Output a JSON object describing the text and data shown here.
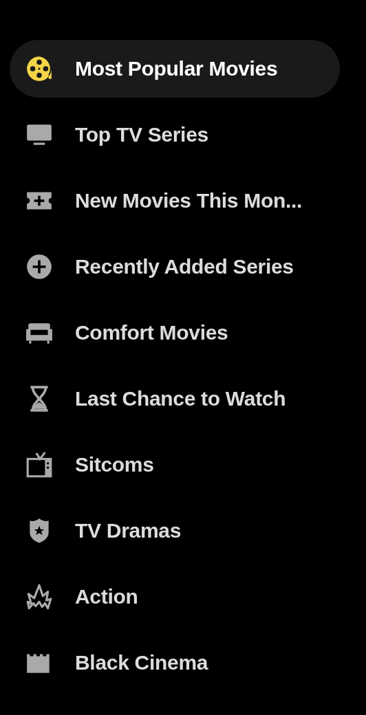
{
  "menu": [
    {
      "label": "Most Popular Movies",
      "kind": "reel",
      "selected": true
    },
    {
      "label": "Top TV Series",
      "kind": "monitor",
      "selected": false
    },
    {
      "label": "New Movies This Mon...",
      "kind": "ticket",
      "selected": false
    },
    {
      "label": "Recently Added Series",
      "kind": "plus",
      "selected": false
    },
    {
      "label": "Comfort Movies",
      "kind": "sofa",
      "selected": false
    },
    {
      "label": "Last Chance to Watch",
      "kind": "hourglass",
      "selected": false
    },
    {
      "label": "Sitcoms",
      "kind": "tv",
      "selected": false
    },
    {
      "label": "TV Dramas",
      "kind": "badge",
      "selected": false
    },
    {
      "label": "Action",
      "kind": "burst",
      "selected": false
    },
    {
      "label": "Black Cinema",
      "kind": "clapper",
      "selected": false
    }
  ]
}
